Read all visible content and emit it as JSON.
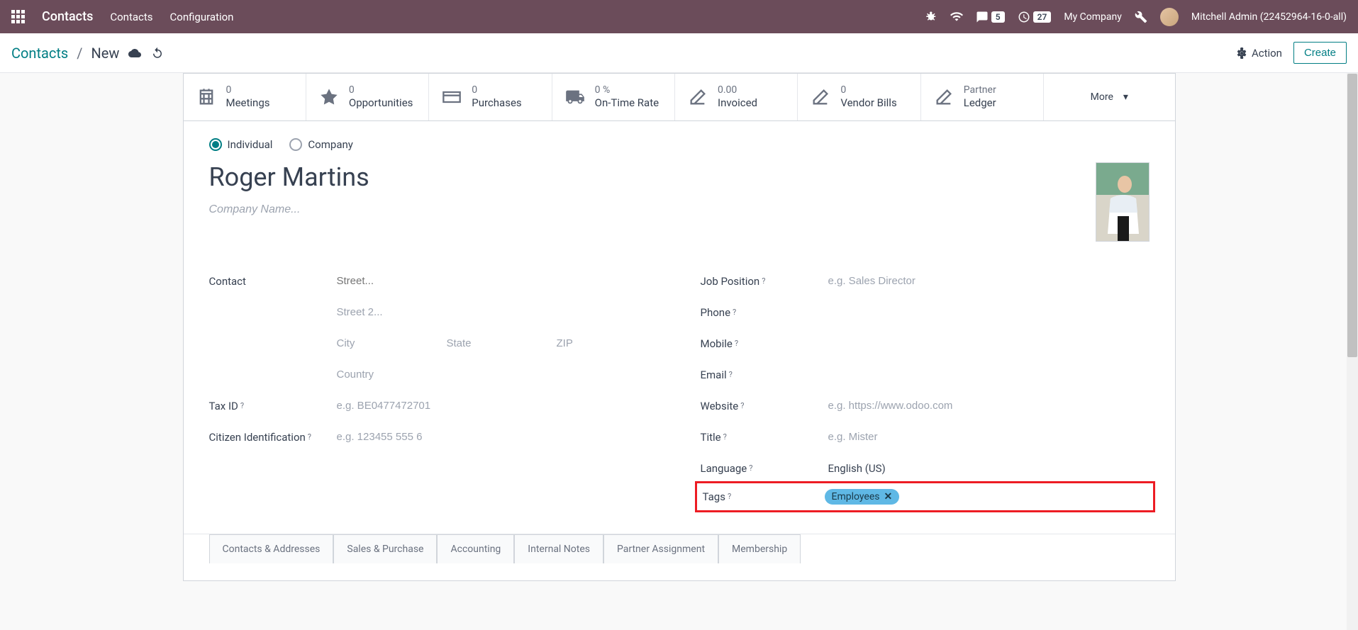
{
  "nav": {
    "title": "Contacts",
    "links": [
      "Contacts",
      "Configuration"
    ],
    "notif1": "5",
    "notif2": "27",
    "company": "My Company",
    "user": "Mitchell Admin (22452964-16-0-all)"
  },
  "breadcrumb": {
    "root": "Contacts",
    "sep": "/",
    "current": "New",
    "action": "Action",
    "create": "Create"
  },
  "stats": [
    {
      "value": "0",
      "label": "Meetings"
    },
    {
      "value": "0",
      "label": "Opportunities"
    },
    {
      "value": "0",
      "label": "Purchases"
    },
    {
      "value": "0 %",
      "label": "On-Time Rate"
    },
    {
      "value": "0.00",
      "label": "Invoiced"
    },
    {
      "value": "0",
      "label": "Vendor Bills"
    },
    {
      "value": "Partner",
      "label": "Ledger"
    }
  ],
  "more": "More",
  "form": {
    "individual": "Individual",
    "company": "Company",
    "name": "Roger Martins",
    "company_placeholder": "Company Name...",
    "contact_label": "Contact",
    "street_ph": "Street...",
    "street2_ph": "Street 2...",
    "city_ph": "City",
    "state_ph": "State",
    "zip_ph": "ZIP",
    "country_ph": "Country",
    "tax_label": "Tax ID",
    "tax_ph": "e.g. BE0477472701",
    "citizen_label": "Citizen Identification",
    "citizen_ph": "e.g. 123455 555 6",
    "job_label": "Job Position",
    "job_ph": "e.g. Sales Director",
    "phone_label": "Phone",
    "mobile_label": "Mobile",
    "email_label": "Email",
    "website_label": "Website",
    "website_ph": "e.g. https://www.odoo.com",
    "title_label": "Title",
    "title_ph": "e.g. Mister",
    "language_label": "Language",
    "language_value": "English (US)",
    "tags_label": "Tags",
    "tag_value": "Employees",
    "help": "?"
  },
  "tabs": [
    "Contacts & Addresses",
    "Sales & Purchase",
    "Accounting",
    "Internal Notes",
    "Partner Assignment",
    "Membership"
  ]
}
